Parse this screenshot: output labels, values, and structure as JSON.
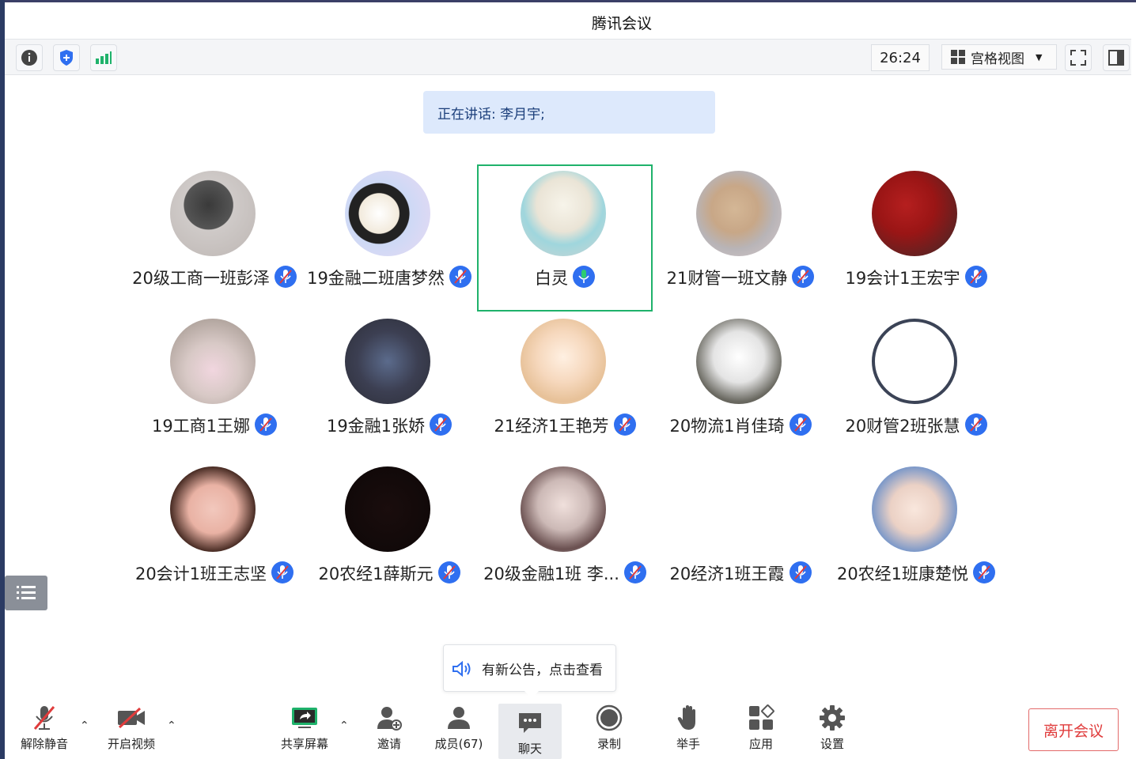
{
  "window": {
    "title": "腾讯会议"
  },
  "toolbar": {
    "timer": "26:24",
    "view_label": "宫格视图"
  },
  "speaking": {
    "text": "正在讲话: 李月宇;"
  },
  "participants": [
    {
      "name": "20级工商一班彭泽",
      "mic": "muted"
    },
    {
      "name": "19金融二班唐梦然",
      "mic": "muted"
    },
    {
      "name": "白灵",
      "mic": "active"
    },
    {
      "name": "21财管一班文静",
      "mic": "muted"
    },
    {
      "name": "19会计1王宏宇",
      "mic": "muted"
    },
    {
      "name": "19工商1王娜",
      "mic": "muted"
    },
    {
      "name": "19金融1张娇",
      "mic": "muted"
    },
    {
      "name": "21经济1王艳芳",
      "mic": "muted"
    },
    {
      "name": "20物流1肖佳琦",
      "mic": "muted"
    },
    {
      "name": "20财管2班张慧",
      "mic": "muted"
    },
    {
      "name": "20会计1班王志坚",
      "mic": "muted"
    },
    {
      "name": "20农经1薛斯元",
      "mic": "muted"
    },
    {
      "name": "20级金融1班 李...",
      "mic": "muted"
    },
    {
      "name": "20经济1班王霞",
      "mic": "muted"
    },
    {
      "name": "20农经1班康楚悦",
      "mic": "muted"
    }
  ],
  "notice": {
    "text": "有新公告，点击查看"
  },
  "bottombar": {
    "unmute": "解除静音",
    "video": "开启视频",
    "share": "共享屏幕",
    "invite": "邀请",
    "members": "成员(67)",
    "chat": "聊天",
    "record": "录制",
    "raise_hand": "举手",
    "apps": "应用",
    "settings": "设置",
    "leave": "离开会议"
  },
  "colors": {
    "accent": "#2f6ff0",
    "active_border": "#1fb26b",
    "leave": "#e03c3c"
  }
}
